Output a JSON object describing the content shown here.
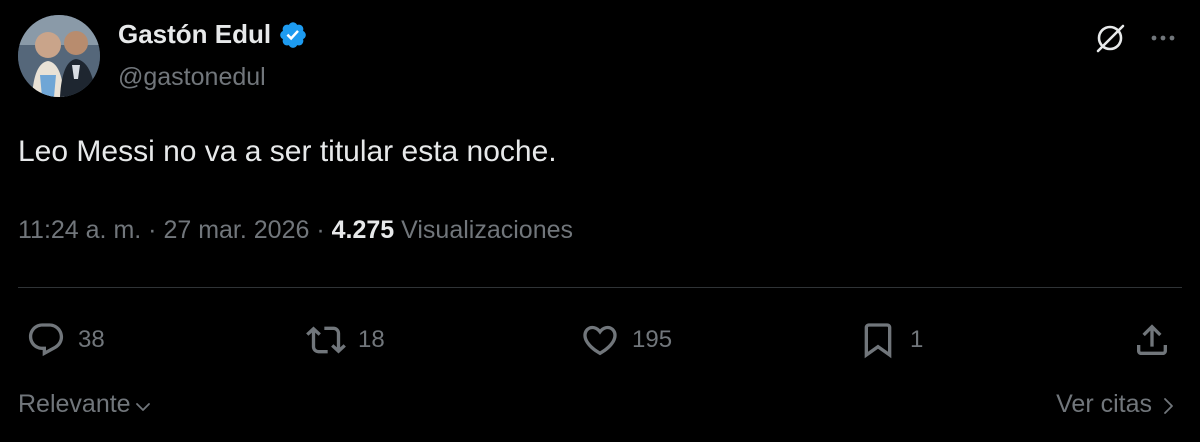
{
  "author": {
    "name": "Gastón Edul",
    "handle": "@gastonedul",
    "verified": true
  },
  "tweet": {
    "text": "Leo Messi no va a ser titular esta noche.",
    "time": "11:24 a. m.",
    "date": "27 mar. 2026",
    "views_count": "4.275",
    "views_label": "Visualizaciones"
  },
  "actions": {
    "replies": "38",
    "retweets": "18",
    "likes": "195",
    "bookmarks": "1"
  },
  "footer": {
    "sort_label": "Relevante",
    "quotes_label": "Ver citas"
  },
  "icons": [
    "grok-icon",
    "more-icon",
    "verified-badge-icon",
    "reply-icon",
    "retweet-icon",
    "like-icon",
    "bookmark-icon",
    "share-icon",
    "chevron-down-icon",
    "chevron-right-icon"
  ],
  "colors": {
    "background": "#000000",
    "text_primary": "#e7e9ea",
    "text_secondary": "#71767b",
    "verified": "#1d9bf0",
    "divider": "#2f3336"
  }
}
